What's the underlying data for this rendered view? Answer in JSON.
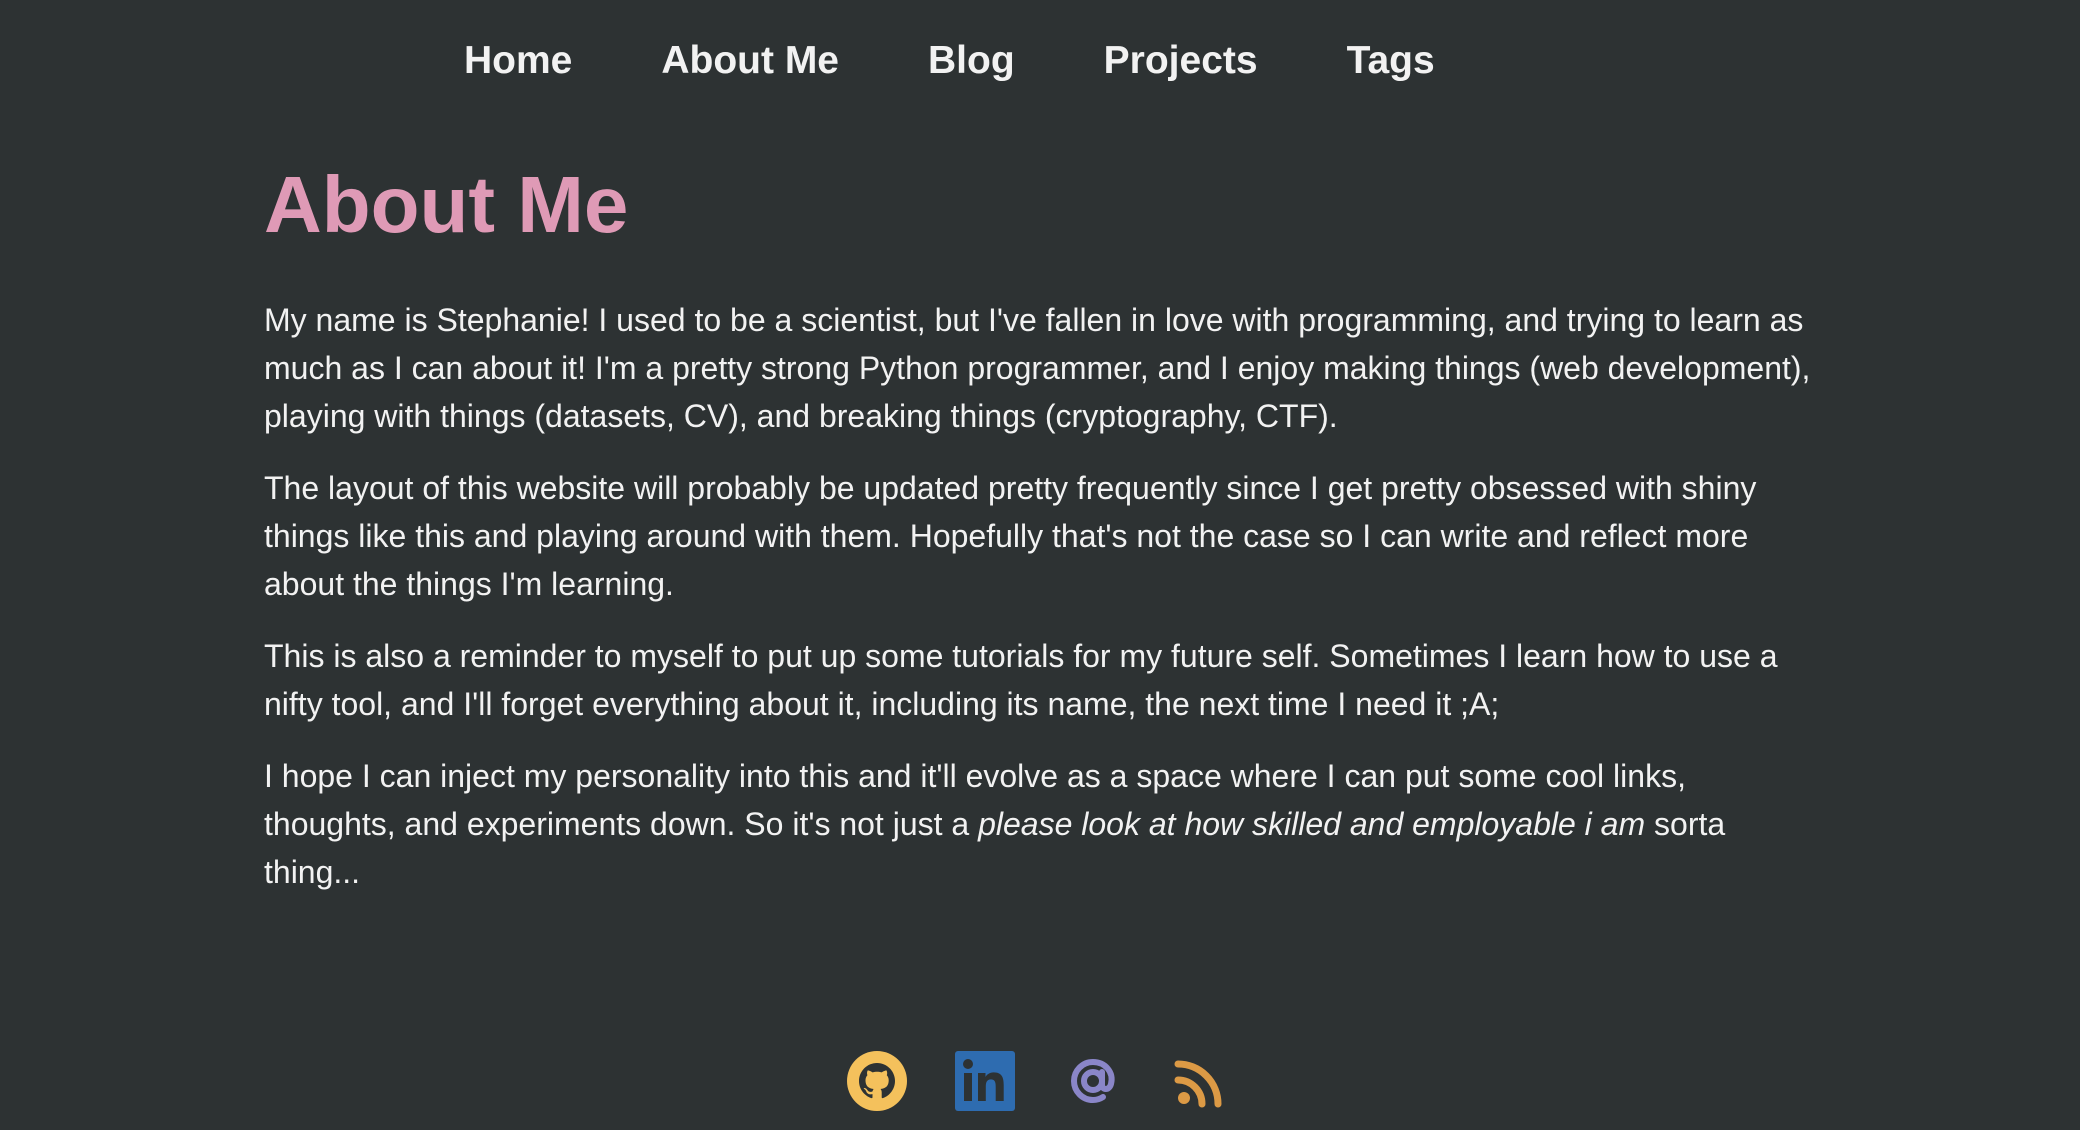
{
  "nav": {
    "items": [
      {
        "label": "Home"
      },
      {
        "label": "About Me"
      },
      {
        "label": "Blog"
      },
      {
        "label": "Projects"
      },
      {
        "label": "Tags"
      }
    ]
  },
  "main": {
    "title": "About Me",
    "p1": "My name is Stephanie! I used to be a scientist, but I've fallen in love with programming, and trying to learn as much as I can about it! I'm a pretty strong Python programmer, and I enjoy making things (web development), playing with things (datasets, CV), and breaking things (cryptography, CTF).",
    "p2": "The layout of this website will probably be updated pretty frequently since I get pretty obsessed with shiny things like this and playing around with them. Hopefully that's not the case so I can write and reflect more about the things I'm learning.",
    "p3": "This is also a reminder to myself to put up some tutorials for my future self. Sometimes I learn how to use a nifty tool, and I'll forget everything about it, including its name, the next time I need it ;A;",
    "p4_before": "I hope I can inject my personality into this and it'll evolve as a space where I can put some cool links, thoughts, and experiments down. So it's not just a ",
    "p4_emphasis": "please look at how skilled and employable i am",
    "p4_after": " sorta thing..."
  },
  "footer": {
    "icons": [
      {
        "name": "github-icon",
        "color": "#f4c15c"
      },
      {
        "name": "linkedin-icon",
        "color": "#2e6cb0"
      },
      {
        "name": "email-icon",
        "color": "#8a86c8"
      },
      {
        "name": "rss-icon",
        "color": "#dc9a45"
      }
    ]
  },
  "colors": {
    "background": "#2d3233",
    "text": "#f2f2f2",
    "heading": "#df9ab6"
  }
}
